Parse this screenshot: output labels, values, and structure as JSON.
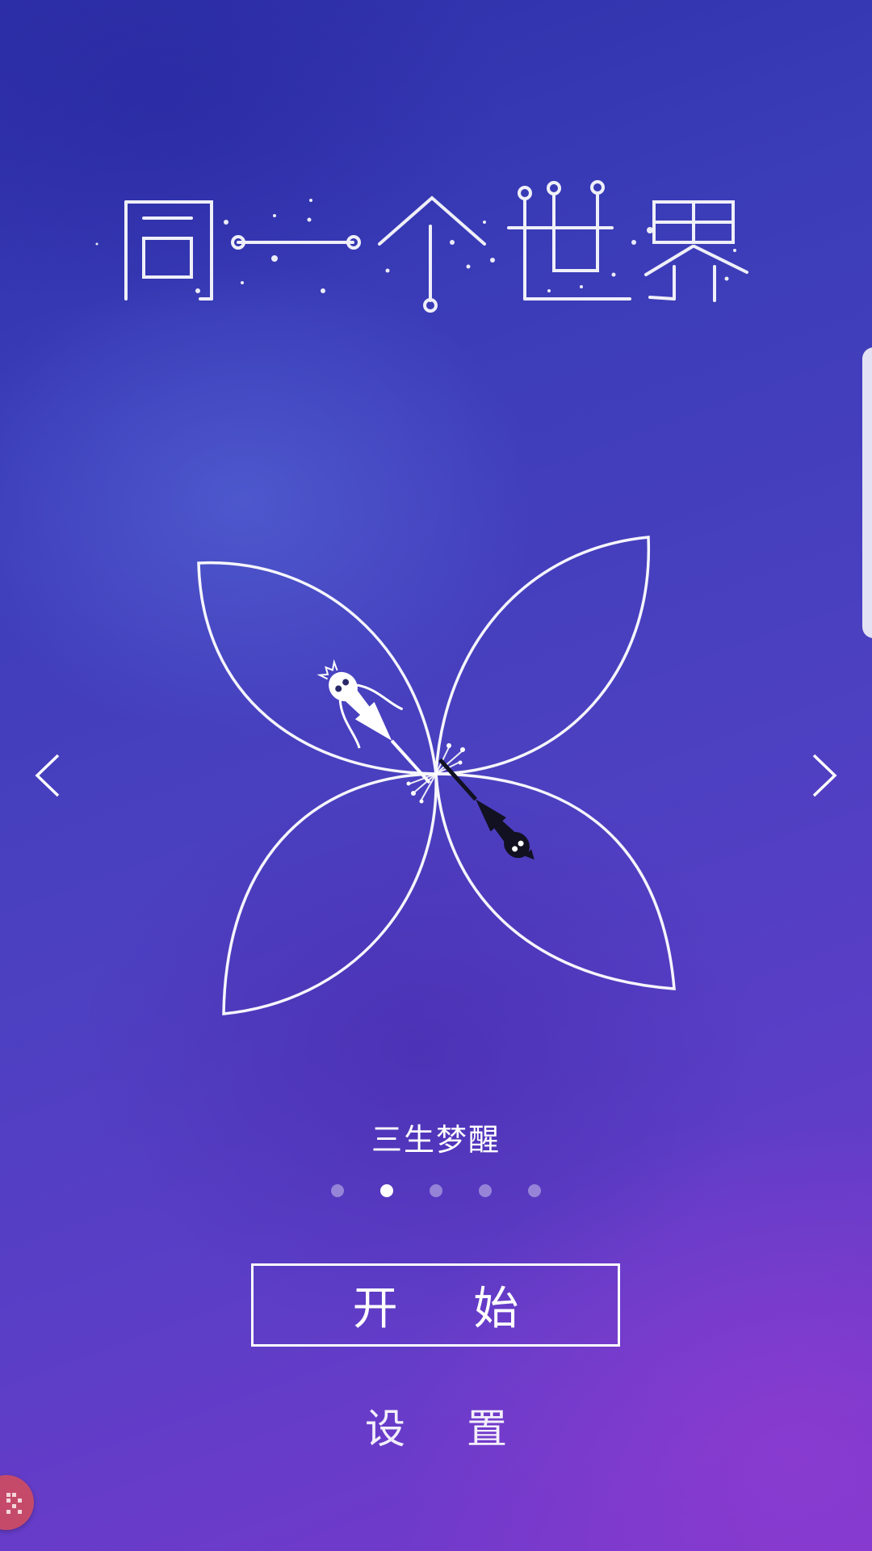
{
  "app": {
    "title_logo_text": "同一个世界"
  },
  "colors": {
    "background_top": "#2c2fa8",
    "background_bottom": "#7a38cc",
    "line_color": "#ffffff",
    "dot_inactive": "rgba(255,255,255,0.38)",
    "dot_active": "#ffffff",
    "floating_button": "#c54a6a"
  },
  "carousel": {
    "level_name": "三生梦醒",
    "prev_icon": "chevron-left-icon",
    "next_icon": "chevron-right-icon",
    "page_count": 5,
    "active_index": 1
  },
  "buttons": {
    "start_label": "开 始",
    "settings_label": "设 置"
  },
  "overlay": {
    "side_handle": "edge-panel-handle",
    "floating_icon": "grid-dots-icon"
  }
}
